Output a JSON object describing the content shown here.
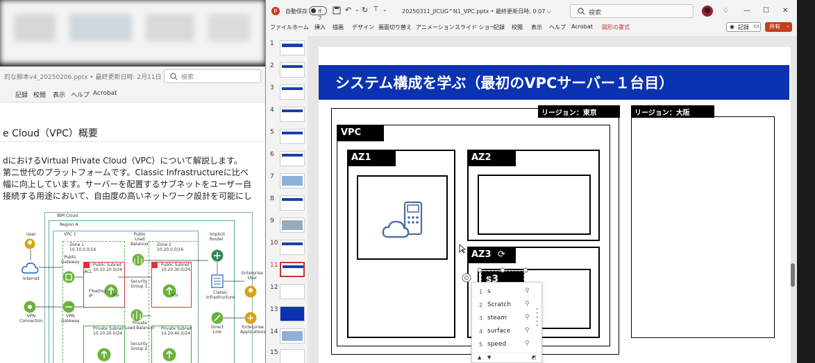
{
  "word": {
    "filename": "的な脚本v4_20250206.pptx • 最終更新日時: 2月11日 ⌵",
    "search_placeholder": "検索",
    "ribbon": [
      "記録",
      "校閲",
      "表示",
      "ヘルプ",
      "Acrobat"
    ],
    "heading": "e Cloud（VPC）概要",
    "paragraph": [
      "dにおけるVirtual Private Cloud（VPC）について解説します。",
      "第二世代のプラットフォームです。Classic Infrastructureに比べ",
      "幅に向上しています。サーバーを配置するサブネットをユーザー自",
      "接続する用途において、自由度の高いネットワーク設計を可能にし"
    ],
    "diagram": {
      "ibm_cloud": "IBM Cloud",
      "region": "Region A",
      "vpc": "VPC 1",
      "zone1": "Zone 1\n10.10.0.0/16",
      "zone2": "Zone 2\n10.20.0.0/16",
      "public_lb": "Public\nLoad\nBalancer",
      "implicit_router": "Implicit\nRouter",
      "user": "User",
      "internet": "Internet",
      "public_gateway": "Public\nGateway",
      "public_subnet1": "Public Subnet\n10.10.10.0/24",
      "public_subnet2": "Public Subnet\n10.20.30.0/24",
      "acl": "ACL",
      "sg1": "Security\nGroup 1",
      "sg2": "Security\nGroup 2",
      "floating_ip": "Floating\nIP",
      "vsi": "VSI",
      "classic": "Classic\nInfrastructure",
      "enterprise_user": "Enterprise\nUser",
      "vpn_connection": "VPN\nConnection",
      "vpn_gateway": "VPN\nGateway",
      "private_lb": "Private\nLoad Balancer",
      "private_subnet1": "Private Subnet\n10.10.20.0/24",
      "private_subnet2": "Private Subnet\n10.20.40.0/24",
      "direct_link": "Direct\nLink",
      "enterprise_apps": "Enterprise\nApplications"
    }
  },
  "ppt": {
    "autosave": "自動保存",
    "autosave_state": "オフ",
    "title": "20250311_JICUG^N1_VPC.pptx • 最終更新日時: 0:07 ⌵",
    "search_placeholder": "検索",
    "menu": [
      "ファイル",
      "ホーム",
      "挿入",
      "描画",
      "デザイン",
      "画面切り替え",
      "アニメーション",
      "スライド ショー",
      "記録",
      "校閲",
      "表示",
      "ヘルプ",
      "Acrobat",
      "図形の書式"
    ],
    "record_btn": "記録",
    "share_btn": "共有",
    "slide_numbers": [
      "1",
      "2",
      "3",
      "4",
      "5",
      "6",
      "7",
      "8",
      "9",
      "10",
      "11",
      "12",
      "13",
      "14",
      "15"
    ],
    "selected_slide": "11",
    "slide": {
      "title": "システム構成を学ぶ（最初のVPCサーバー１台目）",
      "region_tokyo": "リージョン：東京",
      "region_osaka": "リージョン：大阪",
      "vpc": "VPC",
      "az1": "AZ1",
      "az2": "AZ2",
      "az3": "AZ3",
      "editing_text": "s3"
    },
    "autocomplete": [
      {
        "n": "1",
        "w": "s"
      },
      {
        "n": "2",
        "w": "Scratch"
      },
      {
        "n": "3",
        "w": "steam"
      },
      {
        "n": "4",
        "w": "surface"
      },
      {
        "n": "5",
        "w": "speed"
      }
    ]
  }
}
